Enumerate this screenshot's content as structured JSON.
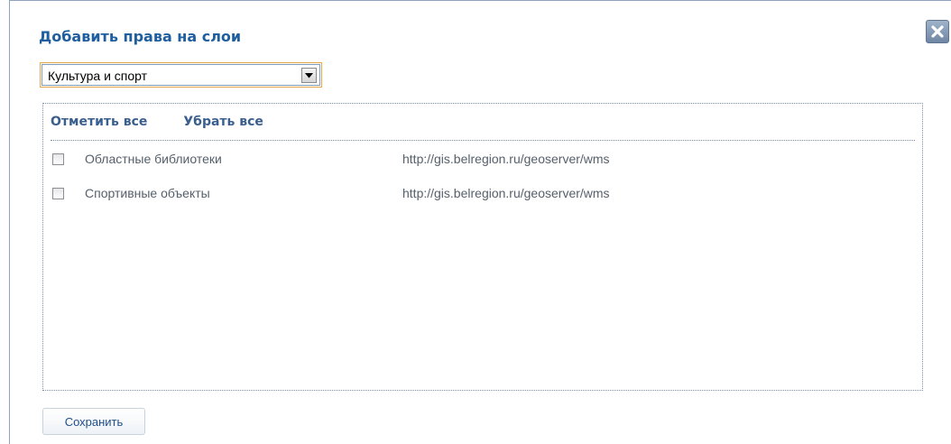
{
  "dialog": {
    "title": "Добавить права на слои",
    "close_icon": "close-icon"
  },
  "category_select": {
    "selected": "Культура и спорт",
    "arrow_icon": "chevron-down-icon"
  },
  "panel": {
    "select_all_label": "Отметить все",
    "clear_all_label": "Убрать все",
    "layers": [
      {
        "name": "Областные библиотеки",
        "url": "http://gis.belregion.ru/geoserver/wms",
        "checked": false
      },
      {
        "name": "Спортивные объекты",
        "url": "http://gis.belregion.ru/geoserver/wms",
        "checked": false
      }
    ]
  },
  "footer": {
    "save_label": "Сохранить"
  },
  "colors": {
    "title": "#1f5fa0",
    "action_link": "#3a5f8e",
    "row_text": "#56606b",
    "select_focus_border": "#e8a44a",
    "panel_border": "#7c8fa6"
  }
}
